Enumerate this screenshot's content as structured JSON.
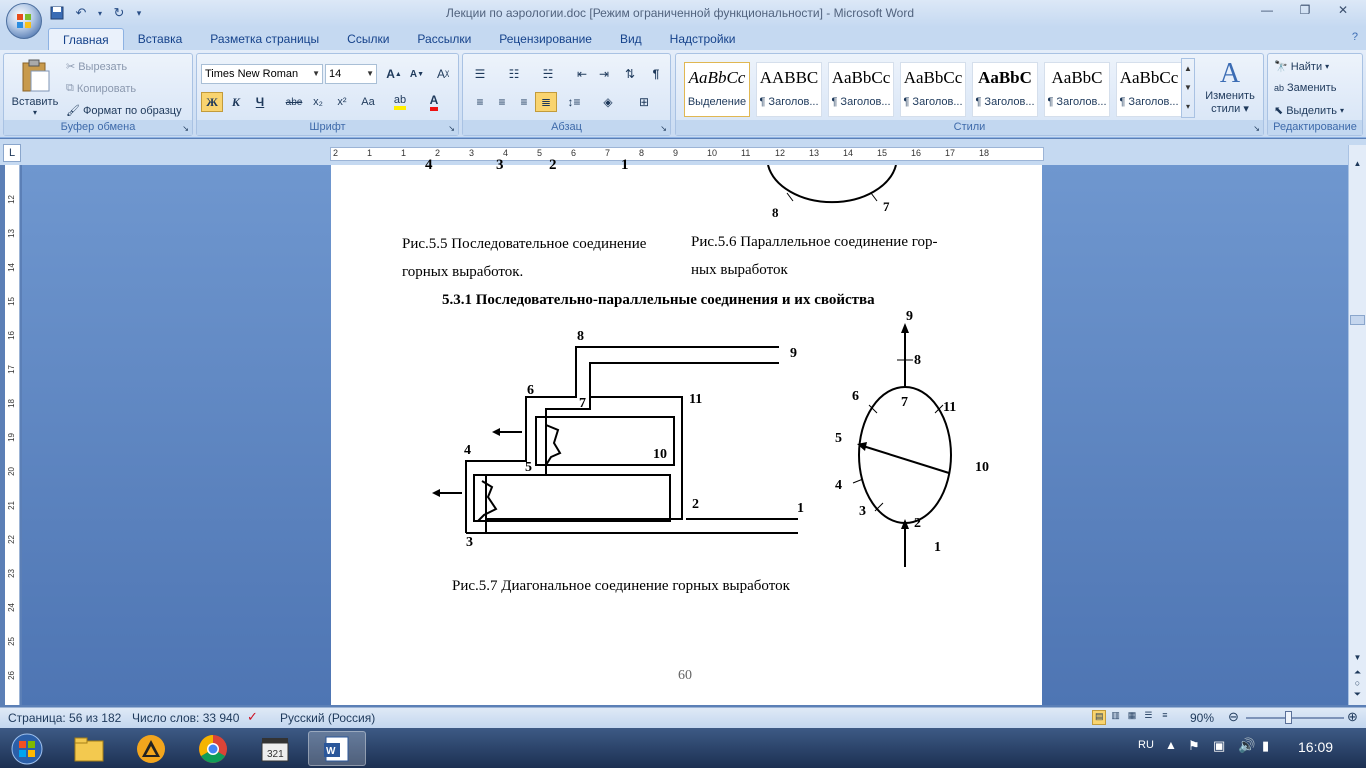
{
  "window": {
    "title": "Лекции по аэрологии.doc [Режим ограниченной функциональности]  -  Microsoft Word"
  },
  "tabs": [
    "Главная",
    "Вставка",
    "Разметка страницы",
    "Ссылки",
    "Рассылки",
    "Рецензирование",
    "Вид",
    "Надстройки"
  ],
  "clipboard": {
    "paste": "Вставить",
    "cut": "Вырезать",
    "copy": "Копировать",
    "format_painter": "Формат по образцу",
    "label": "Буфер обмена"
  },
  "font": {
    "name": "Times New Roman",
    "size": "14",
    "label": "Шрифт",
    "bold": "Ж",
    "italic": "К",
    "underline": "Ч",
    "strike": "abe",
    "sub": "x₂",
    "sup": "x²",
    "case": "Aa"
  },
  "paragraph": {
    "label": "Абзац"
  },
  "styles": {
    "label": "Стили",
    "items": [
      {
        "preview": "AaBbCc",
        "name": "Выделение"
      },
      {
        "preview": "AABBC",
        "name": "¶ Заголов..."
      },
      {
        "preview": "AaBbCc",
        "name": "¶ Заголов..."
      },
      {
        "preview": "AaBbCc",
        "name": "¶ Заголов..."
      },
      {
        "preview": "AaBbC",
        "name": "¶ Заголов..."
      },
      {
        "preview": "AaBbC",
        "name": "¶ Заголов..."
      },
      {
        "preview": "AaBbCc",
        "name": "¶ Заголов..."
      }
    ],
    "change": "Изменить",
    "change2": "стили"
  },
  "editing": {
    "label": "Редактирование",
    "find": "Найти",
    "replace": "Заменить",
    "select": "Выделить"
  },
  "ruler": {
    "ticks": [
      "2",
      "1",
      "1",
      "2",
      "3",
      "4",
      "5",
      "6",
      "7",
      "8",
      "9",
      "10",
      "11",
      "12",
      "13",
      "14",
      "15",
      "16",
      "17",
      "18"
    ],
    "vticks": [
      "12",
      "13",
      "14",
      "15",
      "16",
      "17",
      "18",
      "19",
      "20",
      "21",
      "22",
      "23",
      "24",
      "25",
      "26"
    ]
  },
  "document": {
    "top_labels": {
      "a": "4",
      "b": "3",
      "c": "2",
      "d": "1"
    },
    "fig55_line1": "Рис.5.5 Последовательное соединение",
    "fig55_line2": "горных выработок.",
    "fig56_line1": "Рис.5.6  Параллельное соединение  гор-",
    "fig56_line2": "ных выработок",
    "fig56_nodes": {
      "n8": "8",
      "n7": "7"
    },
    "heading": "5.3.1 Последовательно-параллельные соединения и их свойства",
    "fig57_left_nodes": {
      "n1": "1",
      "n2": "2",
      "n3": "3",
      "n4": "4",
      "n5": "5",
      "n6": "6",
      "n7": "7",
      "n8": "8",
      "n9": "9",
      "n10": "10",
      "n11": "11"
    },
    "fig57_right_nodes": {
      "n1": "1",
      "n2": "2",
      "n3": "3",
      "n4": "4",
      "n5": "5",
      "n6": "6",
      "n7": "7",
      "n8": "8",
      "n9": "9",
      "n10": "10",
      "n11": "11"
    },
    "fig57_caption": "Рис.5.7 Диагональное соединение горных выработок",
    "page_number": "60"
  },
  "status": {
    "page": "Страница: 56 из 182",
    "words": "Число слов: 33 940",
    "language": "Русский (Россия)",
    "zoom": "90%"
  },
  "taskbar": {
    "lang": "RU",
    "time": "16:09"
  }
}
